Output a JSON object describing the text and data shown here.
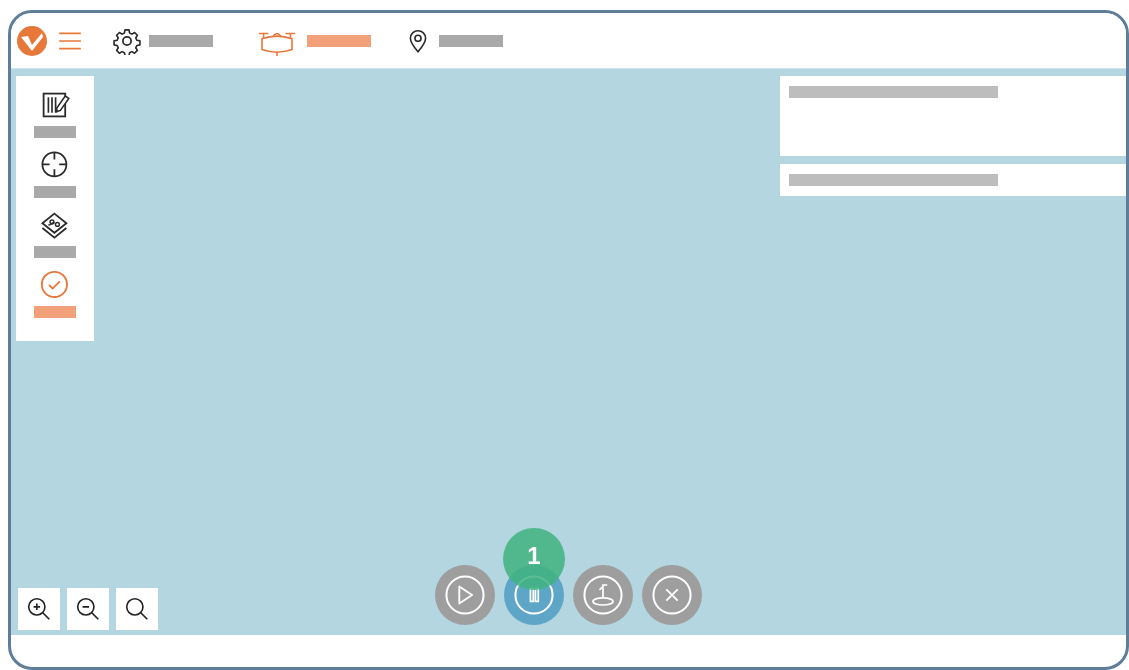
{
  "header": {
    "nav": [
      {
        "kind": "settings",
        "selected": false
      },
      {
        "kind": "drone",
        "selected": true
      },
      {
        "kind": "location",
        "selected": false
      }
    ]
  },
  "sidebar": {
    "items": [
      {
        "kind": "plan",
        "selected": false
      },
      {
        "kind": "target",
        "selected": false
      },
      {
        "kind": "layers",
        "selected": false
      },
      {
        "kind": "check",
        "selected": true
      }
    ]
  },
  "info_panels": [
    {
      "kind": "tall"
    },
    {
      "kind": "short"
    }
  ],
  "zoom_tools": [
    {
      "kind": "zoom-in"
    },
    {
      "kind": "zoom-out"
    },
    {
      "kind": "zoom-fit"
    }
  ],
  "controls": [
    {
      "kind": "play",
      "active": false
    },
    {
      "kind": "pause",
      "active": true
    },
    {
      "kind": "land",
      "active": false
    },
    {
      "kind": "cancel",
      "active": false
    }
  ],
  "badge": "1"
}
